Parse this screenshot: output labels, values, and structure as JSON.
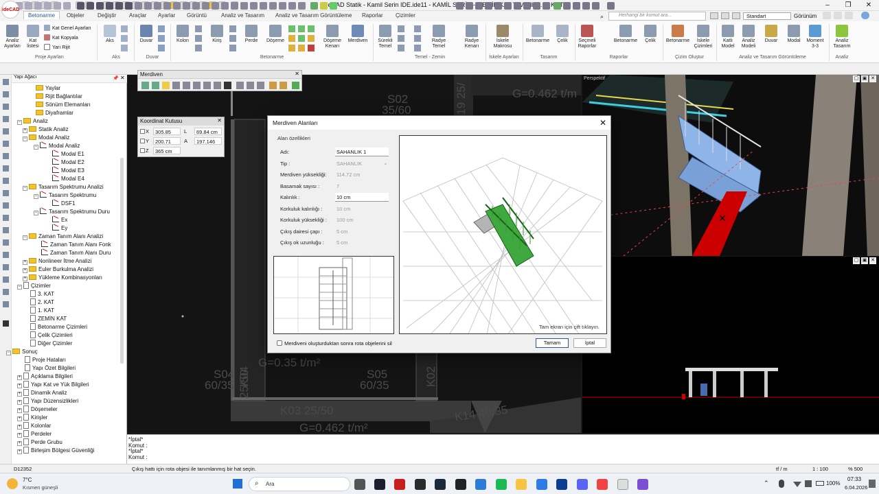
{
  "app": {
    "title": "ideCAD Statik - Kamil Serin IDE.ide11 - KAMİL SERİN - [ZEMİN KAT TAVANI,  3.65 KOTU]",
    "logo": "ideCAD"
  },
  "tabs": [
    "Betonarme",
    "Objeler",
    "Değiştir",
    "Araçlar",
    "Ayarlar",
    "Görüntü",
    "Analiz ve Tasarım",
    "Analiz ve Tasarım Görüntüleme",
    "Raporlar",
    "Çizimler"
  ],
  "active_tab": "Betonarme",
  "search": {
    "placeholder": "Herhangi bir komut ara..."
  },
  "standard_label": "Standart",
  "view_label": "Görünüm",
  "ribbon": {
    "groups": [
      {
        "label": "Proje Ayarları"
      },
      {
        "label": "Aks"
      },
      {
        "label": "Duvar"
      },
      {
        "label": "Betonarme"
      },
      {
        "label": "Temel - Zemin"
      },
      {
        "label": "İskele Ayarları"
      },
      {
        "label": "Tasarım"
      },
      {
        "label": "Raporlar"
      },
      {
        "label": "Çizim Oluştur"
      },
      {
        "label": "Analiz ve Tasarım Görüntüleme"
      },
      {
        "label": "Analiz"
      }
    ],
    "buttons": {
      "analiz_ayarlari": "Analiz Ayarları",
      "kat_listesi": "Kat listesi",
      "kat_genel": "Kat Genel Ayarları",
      "kat_kopyala": "Kat Kopyala",
      "yari_rijit": "Yarı Rijit",
      "aks": "Aks",
      "duvar": "Duvar",
      "kolon": "Kolon",
      "kiris": "Kiriş",
      "perde": "Perde",
      "doseme": "Döşeme",
      "doseme_kenari": "Döşeme Kenarı",
      "merdiven": "Merdiven",
      "surekli_temel": "Sürekli Temel",
      "radye_temel": "Radye Temel",
      "radye_kenari": "Radye Kenarı",
      "iskele_makrosu": "İskele Makrosu",
      "betonarme": "Betonarme",
      "celik": "Çelik",
      "secmeli_raporlar": "Seçmeli Raporlar",
      "betonarme2": "Betonarme",
      "celik2": "Çelik",
      "betonarme3": "Betonarme",
      "iskele_cizimleri": "İskele Çizimleri",
      "katli_model": "Katlı Model",
      "analiz_modeli": "Analiz Modeli",
      "duvar2": "Duvar",
      "modal": "Modal",
      "moment": "Moment 3-3",
      "analiz_tasarim": "Analiz Tasarım"
    }
  },
  "tree": {
    "title": "Yapı Ağacı",
    "items": [
      {
        "label": "Yaylar",
        "icon": "folder"
      },
      {
        "label": "Rijit Bağlantılar",
        "icon": "folder"
      },
      {
        "label": "Sönüm Elemanları",
        "icon": "folder"
      },
      {
        "label": "Diyaframlar",
        "icon": "folder"
      },
      {
        "label": "Analiz",
        "icon": "folder"
      },
      {
        "label": "Statik Analiz",
        "icon": "folder"
      },
      {
        "label": "Modal Analiz",
        "icon": "folder"
      },
      {
        "label": "Modal Analiz",
        "icon": "chart"
      },
      {
        "label": "Modal E1",
        "icon": "chart"
      },
      {
        "label": "Modal E2",
        "icon": "chart"
      },
      {
        "label": "Modal E3",
        "icon": "chart"
      },
      {
        "label": "Modal E4",
        "icon": "chart"
      },
      {
        "label": "Tasarım Spektrumu Analizi",
        "icon": "folder"
      },
      {
        "label": "Tasarım Spektrumu",
        "icon": "chart"
      },
      {
        "label": "DSF1",
        "icon": "chart"
      },
      {
        "label": "Tasarım Spektrumu Duru",
        "icon": "chart"
      },
      {
        "label": "Ex",
        "icon": "chart"
      },
      {
        "label": "Ey",
        "icon": "chart"
      },
      {
        "label": "Zaman Tanım Alanı Analizi",
        "icon": "folder"
      },
      {
        "label": "Zaman Tanım Alanı Fonk",
        "icon": "chart"
      },
      {
        "label": "Zaman Tanım Alanı Duru",
        "icon": "chart"
      },
      {
        "label": "Nonlineer İtme Analizi",
        "icon": "folder"
      },
      {
        "label": "Euler Burkulma Analizi",
        "icon": "folder"
      },
      {
        "label": "Yükleme Kombinasyonları",
        "icon": "folder"
      },
      {
        "label": "Çizimler",
        "icon": "doc"
      },
      {
        "label": "3. KAT",
        "icon": "doc"
      },
      {
        "label": "2. KAT",
        "icon": "doc"
      },
      {
        "label": "1. KAT",
        "icon": "doc"
      },
      {
        "label": "ZEMİN KAT",
        "icon": "doc"
      },
      {
        "label": "Betonarme Çizimleri",
        "icon": "doc"
      },
      {
        "label": "Çelik Çizimleri",
        "icon": "doc"
      },
      {
        "label": "Diğer Çizimler",
        "icon": "doc"
      },
      {
        "label": "Sonuç",
        "icon": "folder"
      },
      {
        "label": "Proje Hataları",
        "icon": "doc"
      },
      {
        "label": "Yapı Özet Bilgileri",
        "icon": "doc"
      },
      {
        "label": "Açıklama Bilgileri",
        "icon": "doc"
      },
      {
        "label": "Yapı Kat ve Yük Bilgileri",
        "icon": "doc"
      },
      {
        "label": "Dinamik Analiz",
        "icon": "doc"
      },
      {
        "label": "Yapı Düzensizlikleri",
        "icon": "doc"
      },
      {
        "label": "Döşemeler",
        "icon": "doc"
      },
      {
        "label": "Kirişler",
        "icon": "doc"
      },
      {
        "label": "Kolonlar",
        "icon": "doc"
      },
      {
        "label": "Perdeler",
        "icon": "doc"
      },
      {
        "label": "Perde Grubu",
        "icon": "doc"
      },
      {
        "label": "Birleşim Bölgesi Güvenliği",
        "icon": "doc"
      }
    ]
  },
  "merdiven_toolbar": {
    "title": "Merdiven"
  },
  "coordinate_box": {
    "title": "Koordinat Kutusu",
    "x": "305.85 cm",
    "l": "69.84 cm",
    "y": "200.71 cm",
    "a": "197.146",
    "z": "365 cm",
    "lx": "X",
    "ly": "Y",
    "lz": "Z",
    "ll": "L",
    "la": "A"
  },
  "plan_labels": {
    "s02": "S02",
    "s02b": "35/60",
    "k19": "K19 25/",
    "k04": "K04",
    "k04b": "25/50",
    "s04": "S04",
    "s04b": "60/35",
    "s05": "S05",
    "s05b": "60/35",
    "k02": "K02",
    "k03": "K03 25/50",
    "k14": "K14  40/35",
    "g1": "G=0.462 t/m",
    "g2": "G=0.35 t/m²",
    "g3": "G=0.462 t/m²"
  },
  "persp_label": "Perspektif",
  "dialog": {
    "title": "Merdiven Alanları",
    "section": "Alan özellikleri",
    "fields": [
      {
        "label": "Adı:",
        "value": "SAHANLIK 1",
        "state": "edit"
      },
      {
        "label": "Tip :",
        "value": "SAHANLIK",
        "state": "dis"
      },
      {
        "label": "Merdiven yüksekliği:",
        "value": "114.72 cm",
        "state": "dis"
      },
      {
        "label": "Basamak sayısı :",
        "value": "7",
        "state": "dis"
      },
      {
        "label": "Kalınlık :",
        "value": "10 cm",
        "state": "edit"
      },
      {
        "label": "Korkuluk kalınlığı :",
        "value": "10 cm",
        "state": "dis"
      },
      {
        "label": "Korkuluk yüksekliği :",
        "value": "100 cm",
        "state": "dis"
      },
      {
        "label": "Çıkış dairesi çapı :",
        "value": "5 cm",
        "state": "dis"
      },
      {
        "label": "Çıkış ok uzunluğu :",
        "value": "5 cm",
        "state": "dis"
      }
    ],
    "preview_hint": "Tam ekran için çift tıklayın.",
    "checkbox_label": "Merdiveni oluşturduktan sonra rota objelerini sil",
    "ok": "Tamam",
    "cancel": "İptal"
  },
  "command": {
    "lines": [
      "*İptal*",
      "Komut :",
      "*İptal*",
      "Komut :"
    ]
  },
  "status": {
    "left": "D12352",
    "message": "Çıkış hattı için rota objesi ile tanımlanmış bir hat seçin.",
    "unit": "tf / m",
    "scale": "1 : 100",
    "zoom": "% 500"
  },
  "taskbar": {
    "weather_temp": "7°C",
    "weather_desc": "Kısmen güneşli",
    "search": "Ara",
    "battery": "100%",
    "time": "07:33",
    "date": "6.04.2026"
  },
  "colors": {
    "accent": "#2b579a",
    "stair_green": "#2e9e2e",
    "stair_blue": "#8fb4e8",
    "error_red": "#cc0000"
  }
}
